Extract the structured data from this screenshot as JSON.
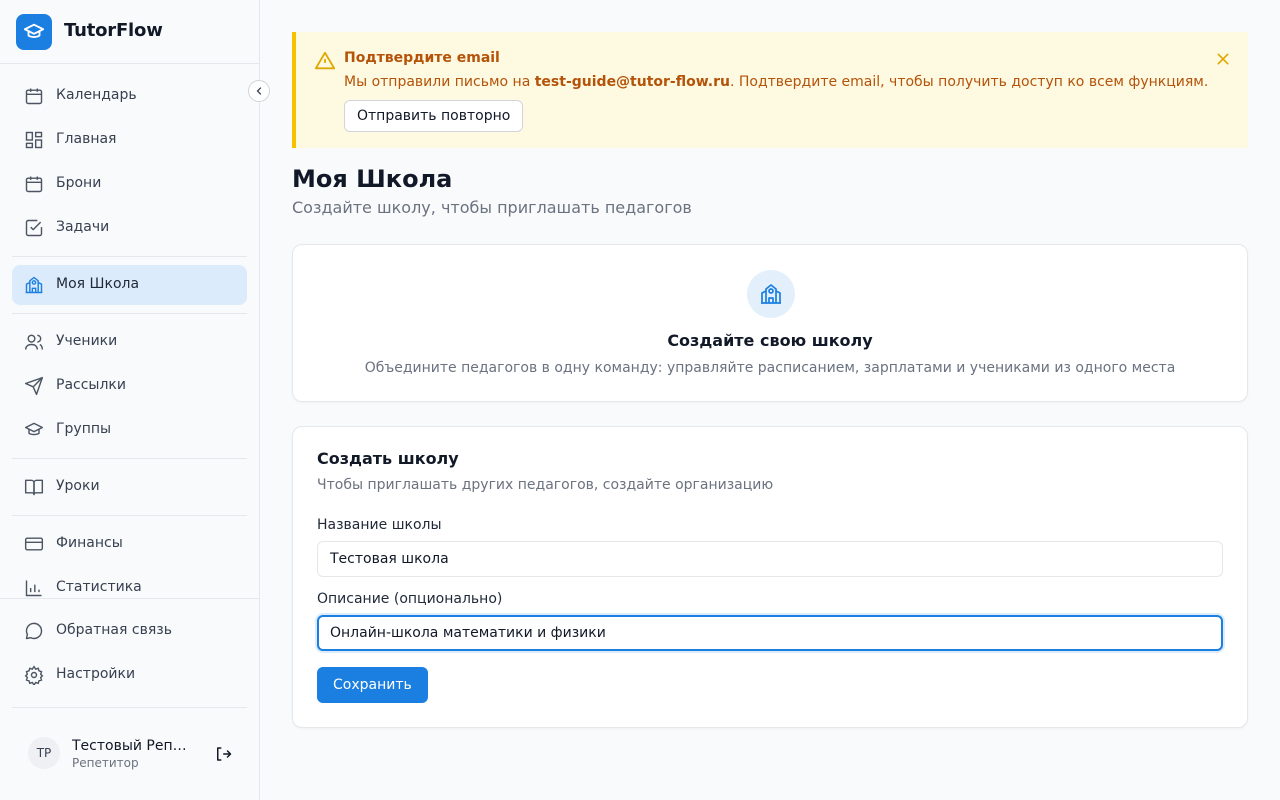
{
  "app": {
    "name": "TutorFlow",
    "logo_icon": "graduation-cap-icon",
    "brand_color": "#1a7fe0"
  },
  "sidebar": {
    "items": [
      {
        "label": "Календарь",
        "icon": "calendar-icon"
      },
      {
        "label": "Главная",
        "icon": "dashboard-icon"
      },
      {
        "label": "Брони",
        "icon": "calendar-icon"
      },
      {
        "label": "Задачи",
        "icon": "checkbox-icon"
      },
      {
        "label": "Моя Школа",
        "icon": "school-icon",
        "active": true
      },
      {
        "label": "Ученики",
        "icon": "users-icon"
      },
      {
        "label": "Рассылки",
        "icon": "send-icon"
      },
      {
        "label": "Группы",
        "icon": "graduation-cap-icon"
      },
      {
        "label": "Уроки",
        "icon": "book-icon"
      },
      {
        "label": "Финансы",
        "icon": "credit-card-icon"
      },
      {
        "label": "Статистика",
        "icon": "bar-chart-icon"
      },
      {
        "label": "Обратная связь",
        "icon": "message-icon"
      },
      {
        "label": "Настройки",
        "icon": "gear-icon"
      }
    ],
    "user": {
      "initials": "TP",
      "name": "Тестовый Репетитор",
      "role": "Репетитор"
    }
  },
  "banner": {
    "title": "Подтвердите email",
    "text_prefix": "Мы отправили письмо на ",
    "email": "test-guide@tutor-flow.ru",
    "text_suffix": ". Подтвердите email, чтобы получить доступ ко всем функциям.",
    "resend_label": "Отправить повторно",
    "color": "#b45309"
  },
  "page": {
    "title": "Моя Школа",
    "subtitle": "Создайте школу, чтобы приглашать педагогов"
  },
  "intro_card": {
    "title": "Создайте свою школу",
    "description": "Объедините педагогов в одну команду: управляйте расписанием, зарплатами и учениками из одного места"
  },
  "form": {
    "title": "Создать школу",
    "description": "Чтобы приглашать других педагогов, создайте организацию",
    "name_label": "Название школы",
    "name_value": "Тестовая школа",
    "desc_label": "Описание (опционально)",
    "desc_value": "Онлайн-школа математики и физики",
    "save_label": "Сохранить"
  }
}
